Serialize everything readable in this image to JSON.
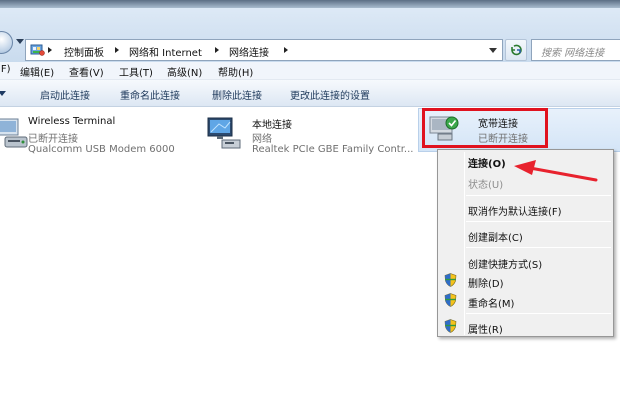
{
  "address_bar": {
    "breadcrumbs": [
      "控制面板",
      "网络和 Internet",
      "网络连接"
    ],
    "search_placeholder": "搜索 网络连接"
  },
  "menu": [
    "(F)",
    "编辑(E)",
    "查看(V)",
    "工具(T)",
    "高级(N)",
    "帮助(H)"
  ],
  "commands": [
    "启动此连接",
    "重命名此连接",
    "删除此连接",
    "更改此连接的设置"
  ],
  "connections": [
    {
      "name": "Wireless Terminal",
      "status": "已断开连接",
      "device": "Qualcomm USB Modem 6000"
    },
    {
      "name": "本地连接",
      "status": "网络",
      "device": "Realtek PCIe GBE Family Contr..."
    },
    {
      "name": "宽带连接",
      "status": "已断开连接",
      "device": ""
    }
  ],
  "context_menu": {
    "items": [
      {
        "label": "连接(O)",
        "style": "bold",
        "shield": false
      },
      {
        "label": "状态(U)",
        "style": "disabled",
        "shield": false
      },
      {
        "label": "取消作为默认连接(F)",
        "style": "normal",
        "shield": false
      },
      {
        "label": "创建副本(C)",
        "style": "normal",
        "shield": false
      },
      {
        "label": "创建快捷方式(S)",
        "style": "normal",
        "shield": false
      },
      {
        "label": "删除(D)",
        "style": "normal",
        "shield": true
      },
      {
        "label": "重命名(M)",
        "style": "normal",
        "shield": true
      },
      {
        "label": "属性(R)",
        "style": "normal",
        "shield": true
      }
    ]
  },
  "colors": {
    "highlight_box": "#e0121f",
    "annotation_arrow": "#e8222e"
  }
}
